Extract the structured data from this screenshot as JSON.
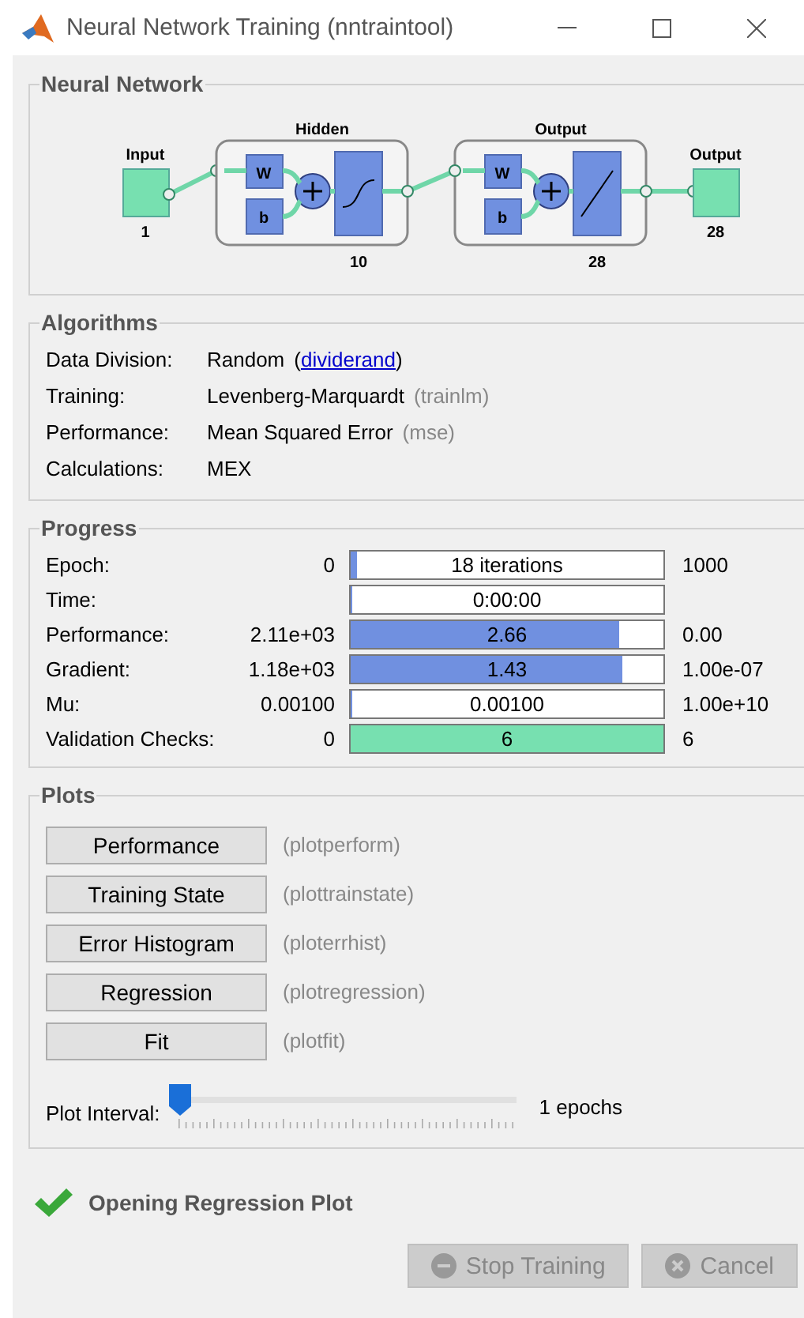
{
  "window": {
    "title": "Neural Network Training (nntraintool)"
  },
  "network": {
    "title": "Neural Network",
    "input": {
      "label": "Input",
      "size": "1"
    },
    "layers": [
      {
        "title": "Hidden",
        "size": "10",
        "kind": "sigmoid",
        "weight": "W",
        "bias": "b"
      },
      {
        "title": "Output",
        "size": "28",
        "kind": "linear",
        "weight": "W",
        "bias": "b"
      }
    ],
    "output": {
      "label": "Output",
      "size": "28"
    }
  },
  "algorithms": {
    "title": "Algorithms",
    "rows": [
      {
        "label": "Data Division:",
        "value": "Random",
        "note_open": "(",
        "link": "dividerand",
        "note_close": ")"
      },
      {
        "label": "Training:",
        "value": "Levenberg-Marquardt",
        "code": "(trainlm)"
      },
      {
        "label": "Performance:",
        "value": "Mean Squared Error",
        "code": "(mse)"
      },
      {
        "label": "Calculations:",
        "value": "MEX"
      }
    ]
  },
  "progress": {
    "title": "Progress",
    "rows": [
      {
        "label": "Epoch:",
        "start": "0",
        "reading": "18 iterations",
        "end": "1000",
        "level": 0.018,
        "color": "#7090e0"
      },
      {
        "label": "Time:",
        "reading": "0:00:00",
        "level": 0,
        "color": "#7090e0"
      },
      {
        "label": "Performance:",
        "start": "2.11e+03",
        "reading": "2.66",
        "end": "0.00",
        "level": 0.86,
        "color": "#7090e0"
      },
      {
        "label": "Gradient:",
        "start": "1.18e+03",
        "reading": "1.43",
        "end": "1.00e-07",
        "level": 0.87,
        "color": "#7090e0"
      },
      {
        "label": "Mu:",
        "start": "0.00100",
        "reading": "0.00100",
        "end": "1.00e+10",
        "level": 0,
        "color": "#7090e0"
      },
      {
        "label": "Validation Checks:",
        "start": "0",
        "reading": "6",
        "end": "6",
        "level": 1,
        "color": "#77e0b0"
      }
    ]
  },
  "plots": {
    "title": "Plots",
    "buttons": [
      {
        "label": "Performance",
        "code": "(plotperform)",
        "disabled": false
      },
      {
        "label": "Training State",
        "code": "(plottrainstate)",
        "disabled": false
      },
      {
        "label": "Error Histogram",
        "code": "(ploterrhist)",
        "disabled": false
      },
      {
        "label": "Regression",
        "code": "(plotregression)",
        "disabled": false
      },
      {
        "label": "Fit",
        "code": "(plotfit)",
        "disabled": false
      }
    ],
    "interval": {
      "label": "Plot Interval:",
      "level": 0,
      "reading": "1 epochs"
    }
  },
  "status": {
    "text": "Opening Regression Plot",
    "done": true
  },
  "buttons": [
    {
      "label": "Stop Training",
      "kind": "stop",
      "disabled": true
    },
    {
      "label": "Cancel",
      "kind": "cancel",
      "disabled": true
    }
  ]
}
